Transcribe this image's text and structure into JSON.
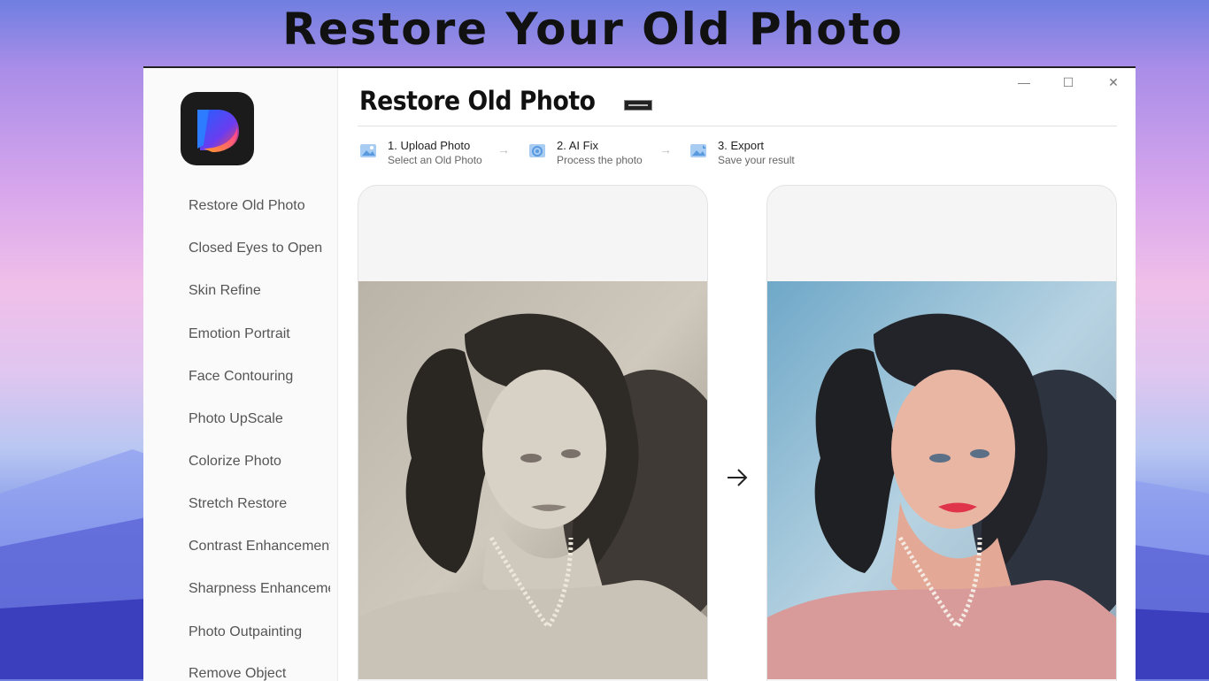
{
  "banner": {
    "title": "Restore Your Old Photo"
  },
  "window": {
    "controls": {
      "minimize": "—",
      "maximize": "☐",
      "close": "✕"
    }
  },
  "sidebar": {
    "items": [
      {
        "label": "Restore Old Photo"
      },
      {
        "label": "Closed Eyes to Open"
      },
      {
        "label": "Skin Refine"
      },
      {
        "label": "Emotion Portrait"
      },
      {
        "label": "Face Contouring"
      },
      {
        "label": "Photo UpScale"
      },
      {
        "label": "Colorize Photo"
      },
      {
        "label": "Stretch Restore"
      },
      {
        "label": "Contrast Enhancement"
      },
      {
        "label": "Sharpness Enhancement"
      },
      {
        "label": "Photo Outpainting"
      },
      {
        "label": "Remove Object"
      }
    ]
  },
  "main": {
    "title": "Restore Old Photo",
    "steps": [
      {
        "title": "1. Upload Photo",
        "subtitle": "Select an Old Photo"
      },
      {
        "title": "2. AI Fix",
        "subtitle": "Process the photo"
      },
      {
        "title": "3. Export",
        "subtitle": "Save your result"
      }
    ],
    "step_separator": "→"
  },
  "colors": {
    "accent_icon": "#7fb3e6",
    "window_bg": "#ffffff",
    "sidebar_bg": "#fafafa"
  }
}
